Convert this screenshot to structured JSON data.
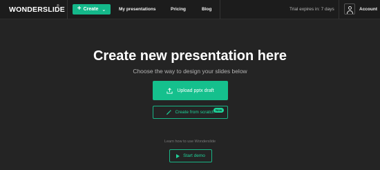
{
  "header": {
    "logo": "WONDERSLIDE",
    "logo_mark": "®",
    "create_label": "Create",
    "nav": [
      "My presentations",
      "Pricing",
      "Blog"
    ],
    "trial_text": "Trial expires in: 7 days",
    "account_label": "Account"
  },
  "main": {
    "title": "Create new presentation here",
    "subtitle": "Choose the way to design your slides below",
    "upload_label": "Upload pptx draft",
    "scratch_label": "Create from scratch",
    "new_badge": "New",
    "learn_text": "Learn how to use Wonderslide",
    "demo_label": "Start demo"
  },
  "colors": {
    "accent": "#15c08d",
    "accent_text": "#1fd49a",
    "background": "#242424",
    "header_bg": "#1c1c1c"
  }
}
